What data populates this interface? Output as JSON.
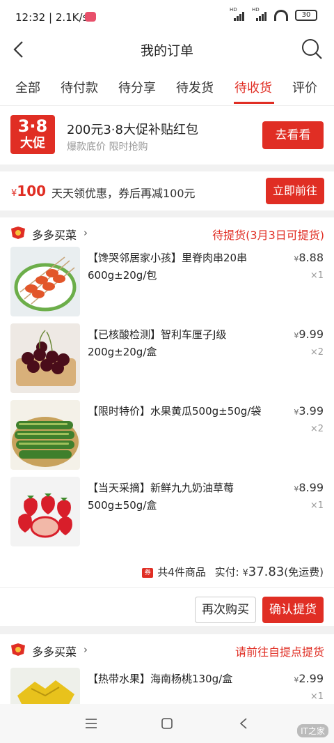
{
  "status_bar": {
    "time": "12:32",
    "speed": "2.1K/s",
    "battery": "30"
  },
  "header": {
    "title": "我的订单"
  },
  "tabs": [
    "全部",
    "待付款",
    "待分享",
    "待发货",
    "待收货",
    "评价"
  ],
  "active_tab": "待收货",
  "promo": {
    "logo_top": "3·8",
    "logo_bottom": "大促",
    "title": "200元3·8大促补贴红包",
    "subtitle": "爆款底价  限时抢购",
    "button": "去看看"
  },
  "coupon": {
    "currency": "¥",
    "amount": "100",
    "text": "天天领优惠，券后再减100元",
    "button": "立即前往"
  },
  "order1": {
    "shop": "多多买菜",
    "status": "待提货(3月3日可提货)",
    "items": [
      {
        "name": "【馋哭邻居家小孩】里脊肉串20串600g±20g/包",
        "price": "8.88",
        "qty": "×1"
      },
      {
        "name": "【已核酸检测】智利车厘子J级200g±20g/盒",
        "price": "9.99",
        "qty": "×2"
      },
      {
        "name": "【限时特价】水果黄瓜500g±50g/袋",
        "price": "3.99",
        "qty": "×2"
      },
      {
        "name": "【当天采摘】新鲜九九奶油草莓500g±50g/盒",
        "price": "8.99",
        "qty": "×1"
      }
    ],
    "coupon_tag": "券",
    "summary_count": "共4件商品",
    "summary_label": "实付:",
    "currency": "¥",
    "total": "37.83",
    "shipping": "(免运费)",
    "btn_rebuy": "再次购买",
    "btn_confirm": "确认提货"
  },
  "order2": {
    "shop": "多多买菜",
    "status": "请前往自提点提货",
    "items": [
      {
        "name": "【热带水果】海南杨桃130g/盒",
        "price": "2.99",
        "qty": "×1"
      }
    ]
  },
  "currency_symbol": "¥",
  "watermark": "IT之家",
  "colors": {
    "accent": "#e02e24",
    "text": "#222222",
    "muted": "#999999"
  }
}
